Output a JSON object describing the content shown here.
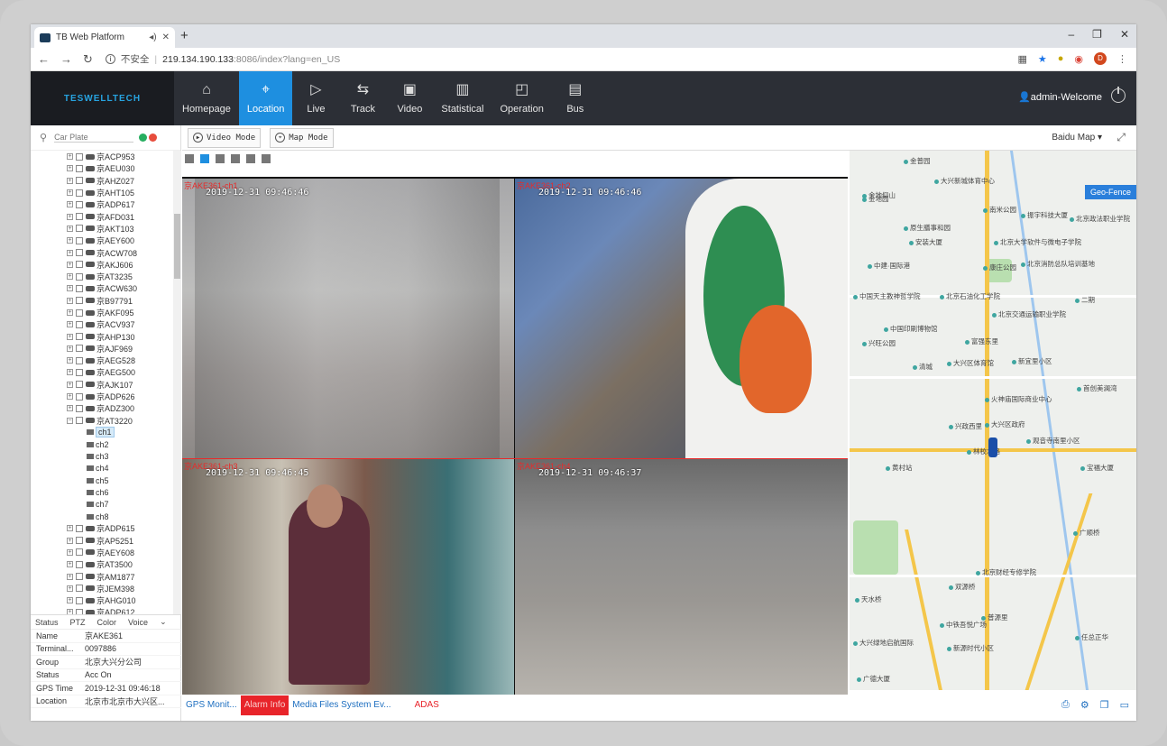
{
  "browser": {
    "tab_title": "TB Web Platform",
    "new_tab": "+",
    "window_controls": [
      "–",
      "❐",
      "✕"
    ],
    "security_label": "不安全",
    "url_host": "219.134.190.133",
    "url_path": ":8086/index?lang=en_US",
    "profile_initial": "D"
  },
  "app": {
    "logo": "TESWELLTECH",
    "user": "admin-Welcome",
    "menu": [
      {
        "label": "Homepage",
        "icon": "⌂"
      },
      {
        "label": "Location",
        "icon": "⌖"
      },
      {
        "label": "Live",
        "icon": "▷"
      },
      {
        "label": "Track",
        "icon": "⇆"
      },
      {
        "label": "Video",
        "icon": "▣"
      },
      {
        "label": "Statistical",
        "icon": "▥"
      },
      {
        "label": "Operation",
        "icon": "◰"
      },
      {
        "label": "Bus",
        "icon": "▤"
      }
    ]
  },
  "sidebar": {
    "search_placeholder": "Car Plate",
    "vehicles_top": [
      "京ACP953",
      "京AEU030",
      "京AHZ027",
      "京AHT105",
      "京ADP617",
      "京AFD031",
      "京AKT103",
      "京AEY600",
      "京ACW708",
      "京AKJ606",
      "京AT3235",
      "京ACW630",
      "京B97791",
      "京AKF095",
      "京ACV937",
      "京AHP130",
      "京AJF969",
      "京AEG528",
      "京AEG500",
      "京AJK107",
      "京ADP626",
      "京ADZ300",
      "京AT3220"
    ],
    "channels": [
      "ch1",
      "ch2",
      "ch3",
      "ch4",
      "ch5",
      "ch6",
      "ch7",
      "ch8"
    ],
    "vehicles_bottom": [
      "京ADP615",
      "京AP5251",
      "京AEY608",
      "京AT3500",
      "京AM1877",
      "京JEM398",
      "京AHG010",
      "京ADP612"
    ],
    "prop_tabs": [
      "Status",
      "PTZ",
      "Color",
      "Voice"
    ],
    "props": [
      {
        "k": "Name",
        "v": "京AKE361"
      },
      {
        "k": "Terminal...",
        "v": "0097886"
      },
      {
        "k": "Group",
        "v": "北京大兴分公司"
      },
      {
        "k": "Status",
        "v": "Acc On"
      },
      {
        "k": "GPS Time",
        "v": "2019-12-31 09:46:18"
      },
      {
        "k": "Location",
        "v": "北京市北京市大兴区..."
      }
    ]
  },
  "toolbar": {
    "video_mode": "Video Mode",
    "map_mode": "Map Mode",
    "map_select": "Baidu Map ▾"
  },
  "videos": [
    {
      "label": "京AKE361-ch1",
      "time": "2019-12-31 09:46:46"
    },
    {
      "label": "京AKE361-ch2",
      "time": "2019-12-31 09:46:46"
    },
    {
      "label": "京AKE361-ch3",
      "time": "2019-12-31 09:46:45"
    },
    {
      "label": "京AKE361-ch4",
      "time": "2019-12-31 09:46:37"
    }
  ],
  "map": {
    "geofence": "Geo-Fence",
    "pois": [
      "金普园",
      "金地园",
      "大兴新城体育中心",
      "金地仰山",
      "南米公园",
      "振宇科技大厦",
      "北京政法职业学院",
      "原生膳事和园",
      "北京大学软件与微电子学院",
      "安装大厦",
      "北京消防总队培训基地",
      "中建·国际港",
      "康庄公园",
      "中国天主教神哲学院",
      "北京石油化工学院",
      "二期",
      "北京交通运输职业学院",
      "中国印刷博物馆",
      "兴旺公园",
      "富强东里",
      "清城",
      "大兴区体育馆",
      "新宜里小区",
      "首创美澜湾",
      "火神庙国际商业中心",
      "大兴区政府",
      "兴政西里",
      "林校北路",
      "观音寺南里小区",
      "黄村站",
      "宝福大厦",
      "广顺桥",
      "北京财经专修学院",
      "双源桥",
      "天水桥",
      "普源里",
      "中铁吾悦广场",
      "大兴绿地启航国际",
      "新源时代小区",
      "广德大厦",
      "任总正华"
    ]
  },
  "bottom": {
    "tabs": [
      "GPS Monit...",
      "Alarm Info",
      "Media Files System Ev...",
      "ADAS"
    ]
  }
}
